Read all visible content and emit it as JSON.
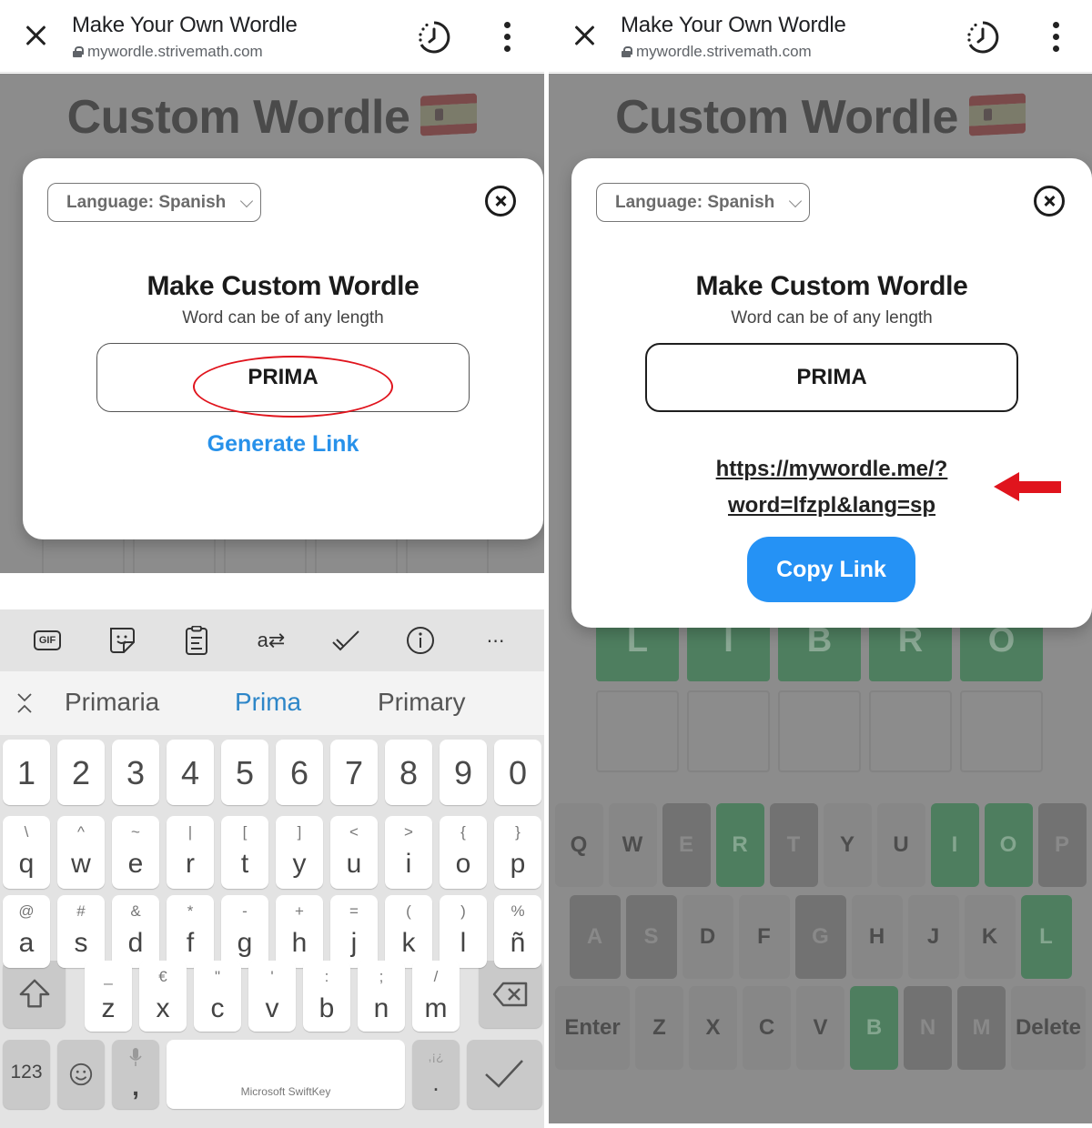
{
  "browser": {
    "title": "Make Your Own Wordle",
    "url": "mywordle.strivemath.com"
  },
  "page": {
    "title": "Custom Wordle",
    "flag": "spain-flag"
  },
  "modal": {
    "language_select": "Language: Spanish",
    "heading": "Make Custom Wordle",
    "subheading": "Word can be of any length",
    "word_value": "PRIMA",
    "generate_label": "Generate Link",
    "share_link_line1": "https://mywordle.me/?",
    "share_link_line2": "word=lfzpl&lang=sp",
    "copy_label": "Copy Link"
  },
  "keyboard": {
    "toolbar_icons": [
      "gif-icon",
      "sticker-icon",
      "clipboard-icon",
      "translate-icon",
      "checkmark-pen-icon",
      "info-icon",
      "more-icon"
    ],
    "gif_label": "GIF",
    "suggestions": [
      "Primaria",
      "Prima",
      "Primary"
    ],
    "selected_suggestion": 1,
    "number_row": [
      "1",
      "2",
      "3",
      "4",
      "5",
      "6",
      "7",
      "8",
      "9",
      "0"
    ],
    "row1": [
      {
        "key": "q",
        "alt": "\\"
      },
      {
        "key": "w",
        "alt": "^"
      },
      {
        "key": "e",
        "alt": "~"
      },
      {
        "key": "r",
        "alt": "|"
      },
      {
        "key": "t",
        "alt": "["
      },
      {
        "key": "y",
        "alt": "]"
      },
      {
        "key": "u",
        "alt": "<"
      },
      {
        "key": "i",
        "alt": ">"
      },
      {
        "key": "o",
        "alt": "{"
      },
      {
        "key": "p",
        "alt": "}"
      }
    ],
    "row2": [
      {
        "key": "a",
        "alt": "@"
      },
      {
        "key": "s",
        "alt": "#"
      },
      {
        "key": "d",
        "alt": "&"
      },
      {
        "key": "f",
        "alt": "*"
      },
      {
        "key": "g",
        "alt": "-"
      },
      {
        "key": "h",
        "alt": "+"
      },
      {
        "key": "j",
        "alt": "="
      },
      {
        "key": "k",
        "alt": "("
      },
      {
        "key": "l",
        "alt": ")"
      },
      {
        "key": "ñ",
        "alt": "%"
      }
    ],
    "row3": [
      {
        "key": "z",
        "alt": "_"
      },
      {
        "key": "x",
        "alt": "€"
      },
      {
        "key": "c",
        "alt": "\""
      },
      {
        "key": "v",
        "alt": "'"
      },
      {
        "key": "b",
        "alt": ":"
      },
      {
        "key": "n",
        "alt": ";"
      },
      {
        "key": "m",
        "alt": "/"
      }
    ],
    "numbers_key": "123",
    "comma_key": ",",
    "period_key": ".",
    "punct_alt": ",¡¿",
    "space_label": "Microsoft SwiftKey"
  },
  "game": {
    "guess_row": [
      "L",
      "I",
      "B",
      "R",
      "O"
    ],
    "keyboard_rows": [
      [
        {
          "k": "Q",
          "s": "unused"
        },
        {
          "k": "W",
          "s": "unused"
        },
        {
          "k": "E",
          "s": "absent"
        },
        {
          "k": "R",
          "s": "correct"
        },
        {
          "k": "T",
          "s": "absent"
        },
        {
          "k": "Y",
          "s": "unused"
        },
        {
          "k": "U",
          "s": "unused"
        },
        {
          "k": "I",
          "s": "correct"
        },
        {
          "k": "O",
          "s": "correct"
        },
        {
          "k": "P",
          "s": "absent"
        }
      ],
      [
        {
          "k": "A",
          "s": "absent"
        },
        {
          "k": "S",
          "s": "absent"
        },
        {
          "k": "D",
          "s": "unused"
        },
        {
          "k": "F",
          "s": "unused"
        },
        {
          "k": "G",
          "s": "absent"
        },
        {
          "k": "H",
          "s": "unused"
        },
        {
          "k": "J",
          "s": "unused"
        },
        {
          "k": "K",
          "s": "unused"
        },
        {
          "k": "L",
          "s": "correct"
        }
      ],
      [
        {
          "k": "Enter",
          "s": "unused"
        },
        {
          "k": "Z",
          "s": "unused"
        },
        {
          "k": "X",
          "s": "unused"
        },
        {
          "k": "C",
          "s": "unused"
        },
        {
          "k": "V",
          "s": "unused"
        },
        {
          "k": "B",
          "s": "correct"
        },
        {
          "k": "N",
          "s": "absent"
        },
        {
          "k": "M",
          "s": "absent"
        },
        {
          "k": "Delete",
          "s": "unused"
        }
      ]
    ]
  },
  "colors": {
    "accent_blue": "#2592f5",
    "link_blue": "#2791ea",
    "annotation_red": "#e0141d",
    "tile_green_dimmed": "#4e7e5f",
    "overlay_gray": "#8c8c8c"
  }
}
